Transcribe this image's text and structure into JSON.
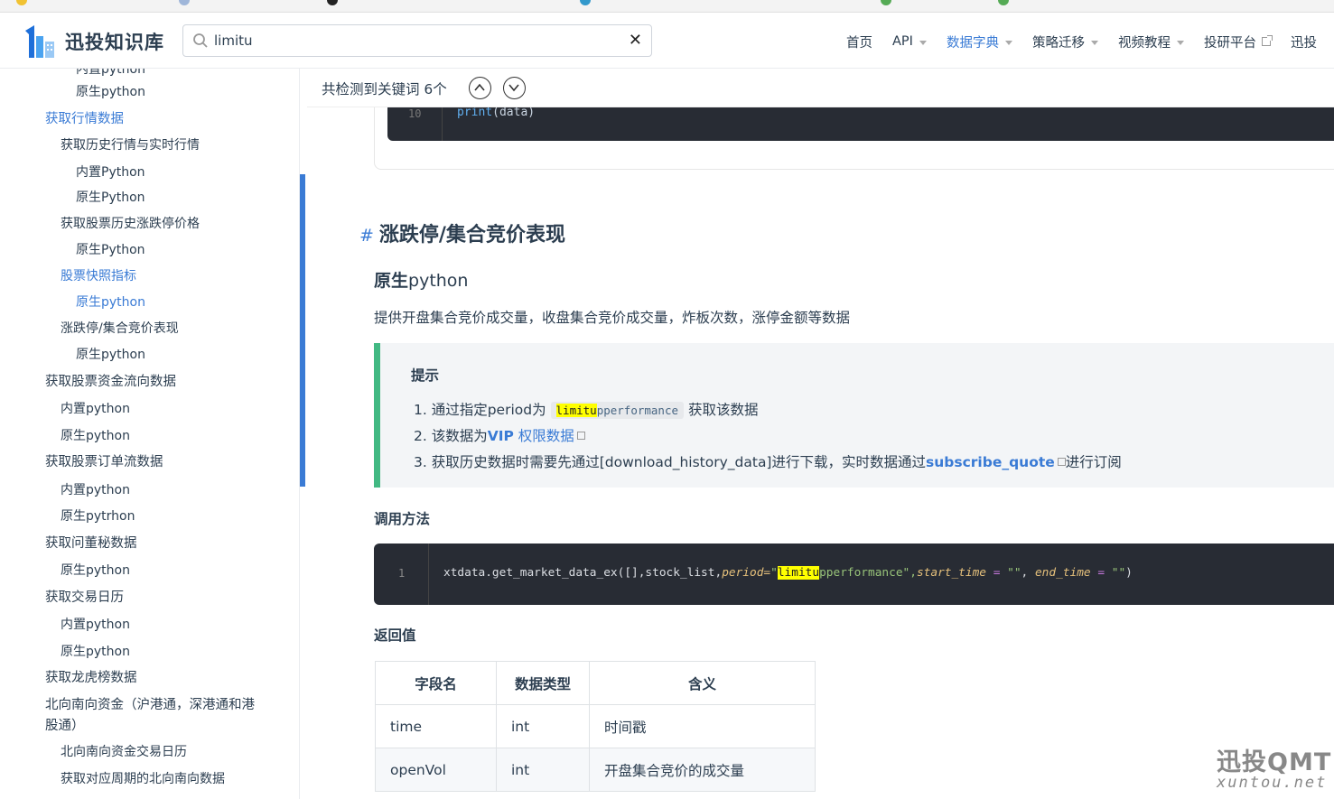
{
  "header": {
    "logo_text": "迅投知识库",
    "search": {
      "value": "limitu",
      "placeholder": ""
    },
    "nav": [
      {
        "label": "首页",
        "has_caret": false
      },
      {
        "label": "API",
        "has_caret": true
      },
      {
        "label": "数据字典",
        "has_caret": true,
        "active": true
      },
      {
        "label": "策略迁移",
        "has_caret": true
      },
      {
        "label": "视频教程",
        "has_caret": true
      },
      {
        "label": "投研平台",
        "external": true
      },
      {
        "label": "迅投"
      }
    ]
  },
  "sidebar": {
    "items": [
      {
        "label": "内置python",
        "level": 3
      },
      {
        "label": "原生python",
        "level": 3
      },
      {
        "label": "获取行情数据",
        "level": 1,
        "active": true
      },
      {
        "label": "获取历史行情与实时行情",
        "level": 2
      },
      {
        "label": "内置Python",
        "level": 3
      },
      {
        "label": "原生Python",
        "level": 3
      },
      {
        "label": "获取股票历史涨跌停价格",
        "level": 2
      },
      {
        "label": "原生Python",
        "level": 3
      },
      {
        "label": "股票快照指标",
        "level": 2,
        "active": true
      },
      {
        "label": "原生python",
        "level": 3,
        "active": true
      },
      {
        "label": "涨跌停/集合竞价表现",
        "level": 2
      },
      {
        "label": "原生python",
        "level": 3
      },
      {
        "label": "获取股票资金流向数据",
        "level": 1
      },
      {
        "label": "内置python",
        "level": 2
      },
      {
        "label": "原生python",
        "level": 2
      },
      {
        "label": "获取股票订单流数据",
        "level": 1
      },
      {
        "label": "内置python",
        "level": 2
      },
      {
        "label": "原生pytrhon",
        "level": 2
      },
      {
        "label": "获取问董秘数据",
        "level": 1
      },
      {
        "label": "原生python",
        "level": 2
      },
      {
        "label": "获取交易日历",
        "level": 1
      },
      {
        "label": "内置python",
        "level": 2
      },
      {
        "label": "原生python",
        "level": 2
      },
      {
        "label": "获取龙虎榜数据",
        "level": 1
      },
      {
        "label": "北向南向资金（沪港通，深港通和港",
        "level": 1
      },
      {
        "label": "股通）",
        "level": 1
      },
      {
        "label": "北向南向资金交易日历",
        "level": 2
      },
      {
        "label": "获取对应周期的北向南向数据",
        "level": 2
      }
    ]
  },
  "main": {
    "keyword_bar": {
      "text": "共检测到关键词 6个"
    },
    "prev_code": {
      "line_no": "10",
      "fn": "print",
      "rest": "(data)"
    },
    "section_title": "涨跌停/集合竞价表现",
    "section_hash": "#",
    "subtitle_bold": "原生",
    "subtitle_rest": "python",
    "description": "提供开盘集合竞价成交量，收盘集合竞价成交量，炸板次数，涨停金额等数据",
    "tip": {
      "title": "提示",
      "item1_prefix": "1. 通过指定period为",
      "item1_code_hl": "limitu",
      "item1_code_rest": "pperformance",
      "item1_suffix": "获取该数据",
      "item2_prefix": "2. 该数据为",
      "item2_link_bold": "VIP",
      "item2_link_rest": " 权限数据",
      "item3_prefix": "3. 获取历史数据时需要先通过[download_history_data]进行下载，实时数据通过",
      "item3_link": "subscribe_quote",
      "item3_suffix": "进行订阅"
    },
    "call_heading": "调用方法",
    "call_code": {
      "line_no": "1",
      "p1": "xtdata.get_market_data_ex([],stock_list,",
      "kw_period": "period=",
      "q1": "\"",
      "hl": "limitu",
      "rest": "pperformance",
      "q2": "\",",
      "kw_start": "start_time",
      "eq1": " = ",
      "s1": "\"\"",
      "comma": ", ",
      "kw_end": "end_time",
      "eq2": " = ",
      "s2": "\"\"",
      "close": ")"
    },
    "return_heading": "返回值",
    "table": {
      "headers": [
        "字段名",
        "数据类型",
        "含义"
      ],
      "rows": [
        [
          "time",
          "int",
          "时间戳"
        ],
        [
          "openVol",
          "int",
          "开盘集合竞价的成交量"
        ]
      ]
    }
  },
  "watermark": {
    "big": "迅投QMT",
    "small": "xuntou.net"
  },
  "colors": {
    "accent": "#3a7bd5",
    "tip_border": "#42b983",
    "code_bg": "#282c34",
    "highlight": "#ffff00"
  }
}
